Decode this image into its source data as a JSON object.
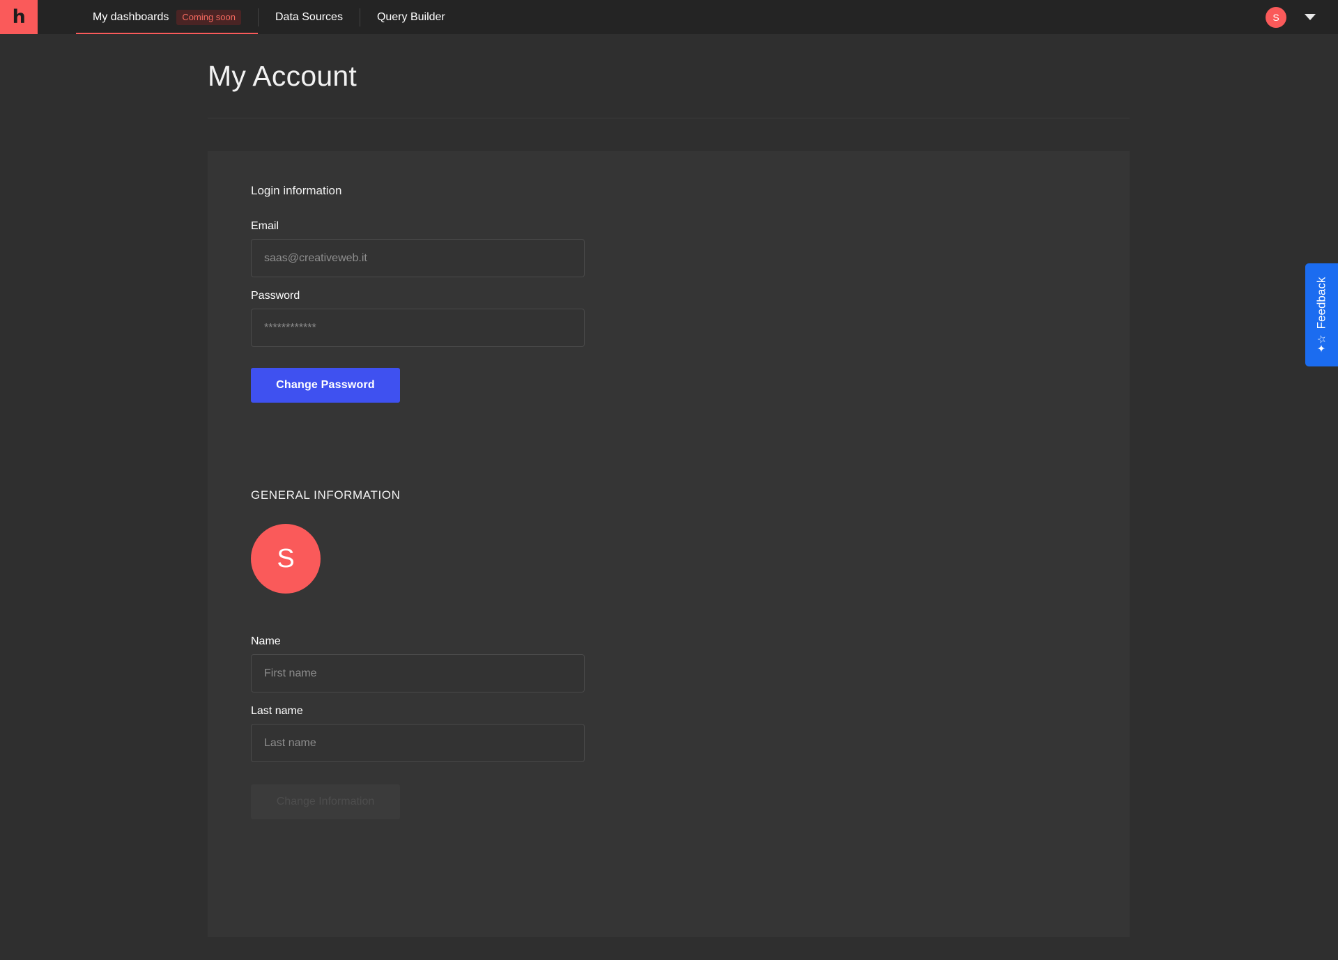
{
  "topnav": {
    "logo_glyph": "h",
    "tabs": [
      {
        "label": "My dashboards",
        "badge": "Coming soon",
        "active": true
      },
      {
        "label": "Data Sources",
        "badge": "",
        "active": false
      },
      {
        "label": "Query Builder",
        "badge": "",
        "active": false
      }
    ],
    "avatar_initial": "S",
    "caret_icon": "chevron-down-icon"
  },
  "page": {
    "title": "My Account"
  },
  "login_section": {
    "title": "Login information",
    "email_label": "Email",
    "email_value": "",
    "email_placeholder": "saas@creativeweb.it",
    "password_label": "Password",
    "password_value": "",
    "password_placeholder": "************",
    "change_password_button": "Change Password"
  },
  "general_section": {
    "title": "GENERAL INFORMATION",
    "avatar_initial": "S",
    "name_label": "Name",
    "first_name_value": "",
    "first_name_placeholder": "First name",
    "last_name_label": "Last name",
    "last_name_value": "",
    "last_name_placeholder": "Last name",
    "change_information_button": "Change Information"
  },
  "feedback": {
    "label": "Feedback",
    "icon": "star-sparkle-icon",
    "icon_glyph": "✦☆"
  },
  "colors": {
    "brand_coral": "#fa5a5a",
    "primary_blue": "#3f51f0",
    "feedback_blue": "#1b6cf0",
    "page_bg": "#2f2f2f",
    "card_bg": "#353535",
    "topbar_bg": "#242424"
  }
}
